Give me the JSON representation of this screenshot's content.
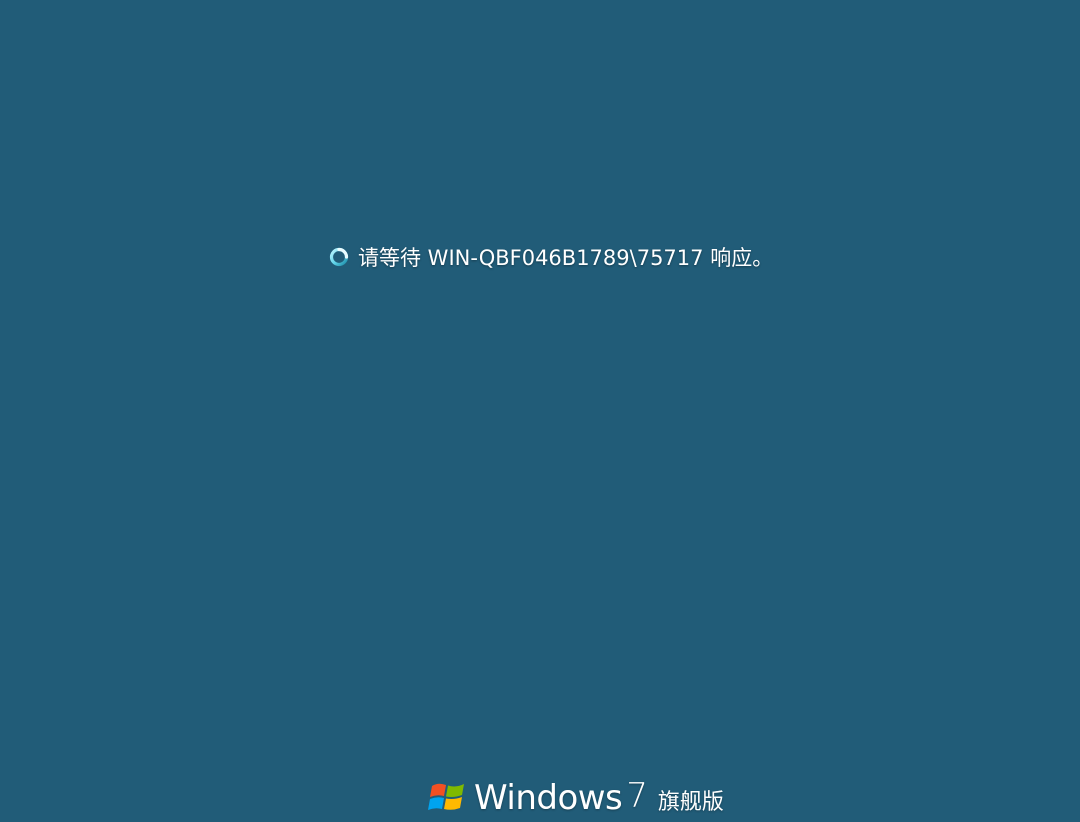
{
  "status": {
    "message": "请等待 WIN-QBF046B1789\\75717 响应。",
    "icon": "busy-spinner-icon"
  },
  "branding": {
    "product": "Windows",
    "version": "7",
    "edition": "旗舰版",
    "logo_icon": "windows-flag-icon"
  },
  "colors": {
    "background": "#215c78",
    "text": "#ffffff",
    "spinner": "#5fd3e8"
  }
}
